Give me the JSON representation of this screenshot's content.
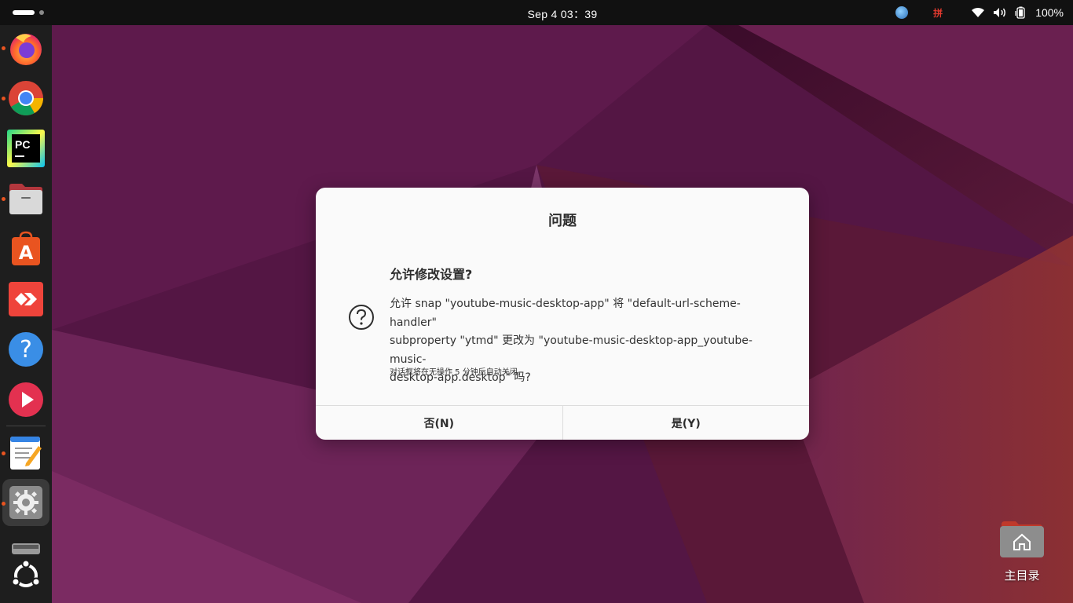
{
  "topbar": {
    "clock": "Sep 4  03：39",
    "ime_label": "拼",
    "battery": "100%",
    "icons": [
      "activities-pill-icon",
      "app-indicator-icon",
      "wifi-icon",
      "volume-icon",
      "battery-icon"
    ]
  },
  "dock": {
    "items": [
      {
        "name": "firefox",
        "icon": "firefox-icon",
        "running": true
      },
      {
        "name": "chrome",
        "icon": "chrome-icon",
        "running": true
      },
      {
        "name": "pycharm",
        "icon": "pycharm-icon",
        "running": false
      },
      {
        "name": "files",
        "icon": "files-icon",
        "running": true
      },
      {
        "name": "app-center",
        "icon": "app-center-icon",
        "running": false
      },
      {
        "name": "anydesk",
        "icon": "anydesk-icon",
        "running": false
      },
      {
        "name": "help",
        "icon": "help-icon",
        "running": false
      },
      {
        "name": "youtube-music",
        "icon": "play-icon",
        "running": false
      },
      {
        "name": "text-editor",
        "icon": "text-editor-icon",
        "running": true
      },
      {
        "name": "settings",
        "icon": "gear-icon",
        "running": true,
        "active": true
      },
      {
        "name": "drive",
        "icon": "drive-icon",
        "running": false
      },
      {
        "name": "show-apps",
        "icon": "ubuntu-logo-icon",
        "running": false
      }
    ]
  },
  "desktop": {
    "home_label": "主目录"
  },
  "dialog": {
    "title": "问题",
    "heading": "允许修改设置?",
    "body_line1": "允许 snap \"youtube-music-desktop-app\" 将 \"default-url-scheme-handler\"",
    "body_line2": "subproperty \"ytmd\" 更改为 \"youtube-music-desktop-app_youtube-music-",
    "body_line3": "desktop-app.desktop\" 吗?",
    "note": "对话框将在无操作 5 分钟后自动关闭。",
    "no_label": "否(N)",
    "yes_label": "是(Y)"
  },
  "colors": {
    "accent": "#e95420",
    "topbar": "#111111",
    "dock": "#1e1e1e",
    "dialog_bg": "#fafafa"
  }
}
